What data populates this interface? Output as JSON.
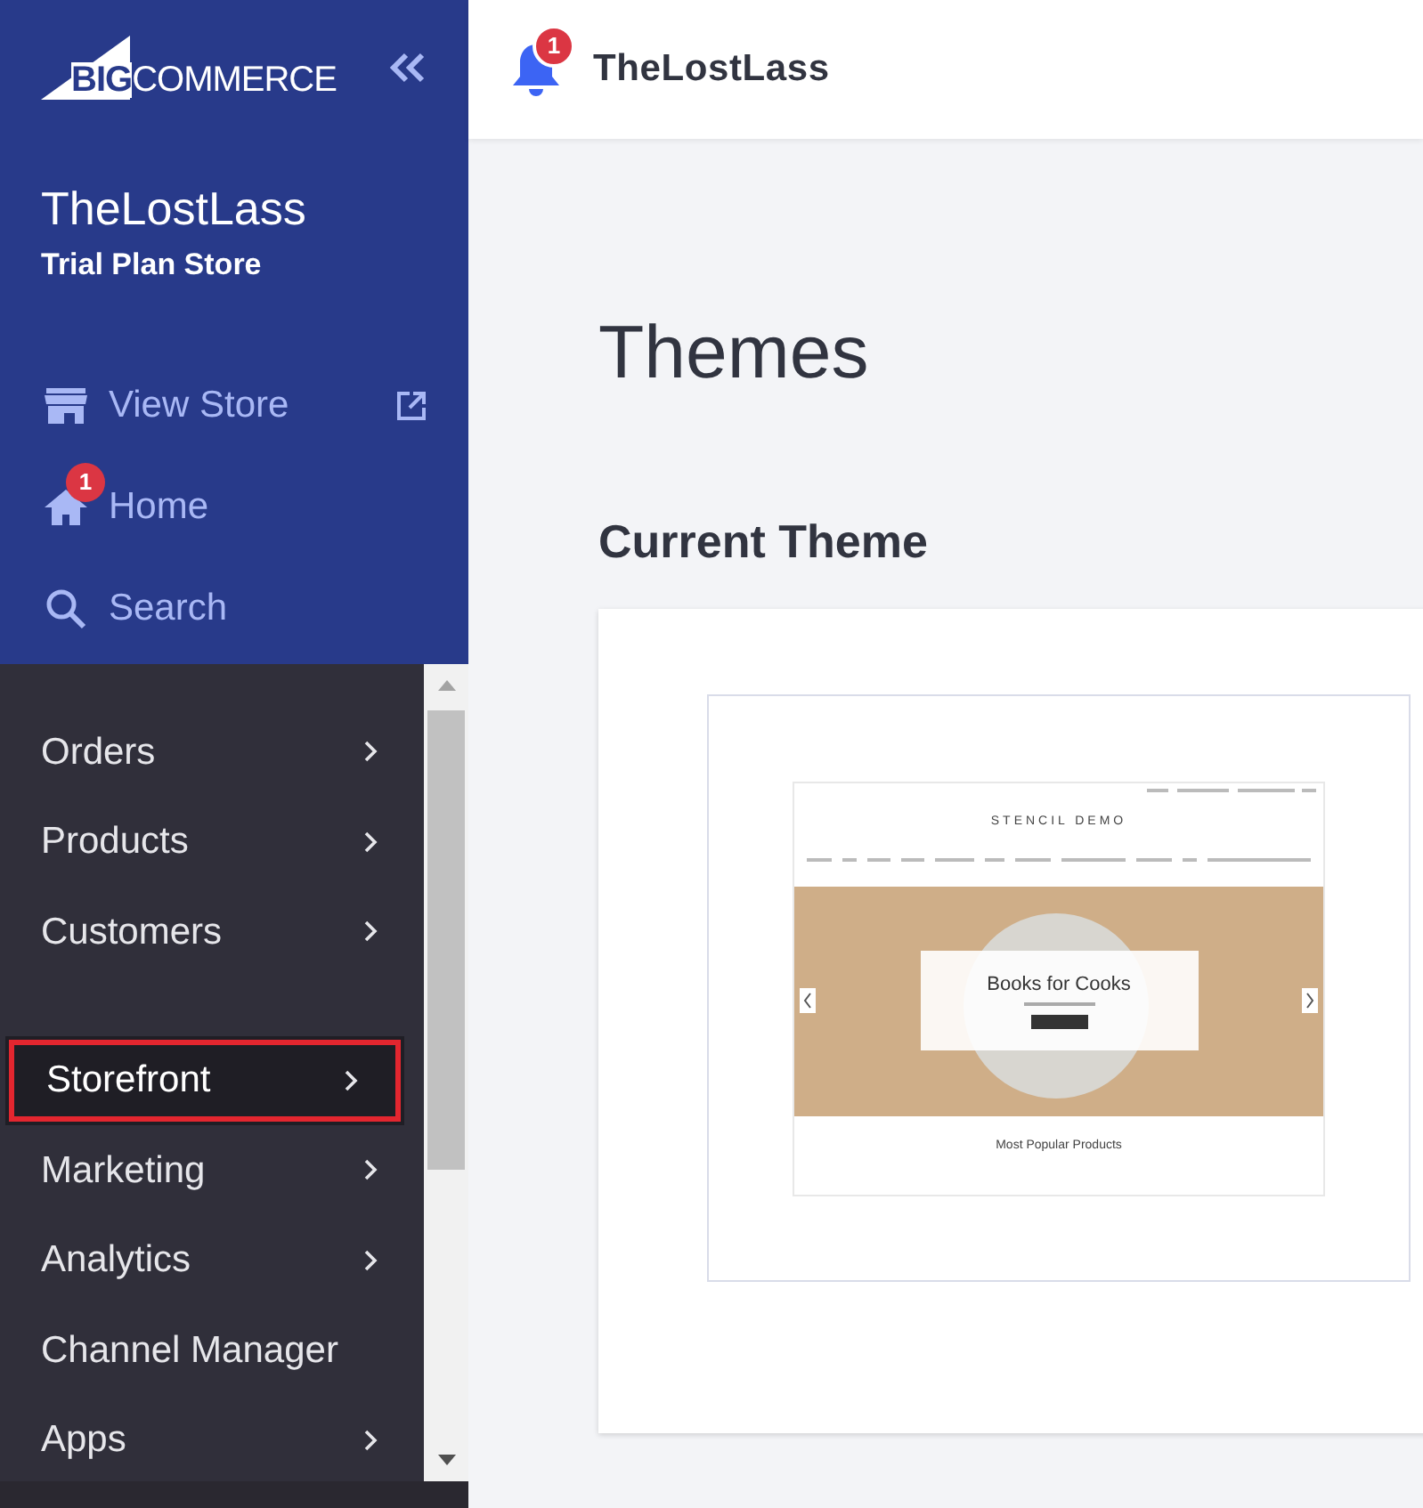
{
  "sidebar": {
    "logo": [
      "BIG",
      "COMMERCE"
    ],
    "store_name": "TheLostLass",
    "plan": "Trial Plan Store",
    "links": [
      {
        "kind": "store",
        "label": "View Store"
      },
      {
        "kind": "home",
        "label": "Home",
        "badge": "1"
      },
      {
        "kind": "search",
        "label": "Search"
      }
    ],
    "menu": [
      {
        "label": "Orders",
        "chevron": true,
        "selected": false,
        "highlighted": false,
        "gap_after": false
      },
      {
        "label": "Products",
        "chevron": true,
        "selected": false,
        "highlighted": false,
        "gap_after": false
      },
      {
        "label": "Customers",
        "chevron": true,
        "selected": false,
        "highlighted": false,
        "gap_after": true
      },
      {
        "label": "Storefront",
        "chevron": true,
        "selected": true,
        "highlighted": true,
        "gap_after": false
      },
      {
        "label": "Marketing",
        "chevron": true,
        "selected": false,
        "highlighted": false,
        "gap_after": false
      },
      {
        "label": "Analytics",
        "chevron": true,
        "selected": false,
        "highlighted": false,
        "gap_after": false
      },
      {
        "label": "Channel Manager",
        "chevron": false,
        "selected": false,
        "highlighted": false,
        "gap_after": false
      },
      {
        "label": "Apps",
        "chevron": true,
        "selected": false,
        "highlighted": false,
        "gap_after": false
      }
    ]
  },
  "header": {
    "notification_badge": "1",
    "store_name": "TheLostLass"
  },
  "page": {
    "title": "Themes",
    "section": "Current Theme",
    "preview": {
      "site_title": "STENCIL DEMO",
      "hero_title": "Books for Cooks",
      "products_heading": "Most Popular Products"
    }
  }
}
